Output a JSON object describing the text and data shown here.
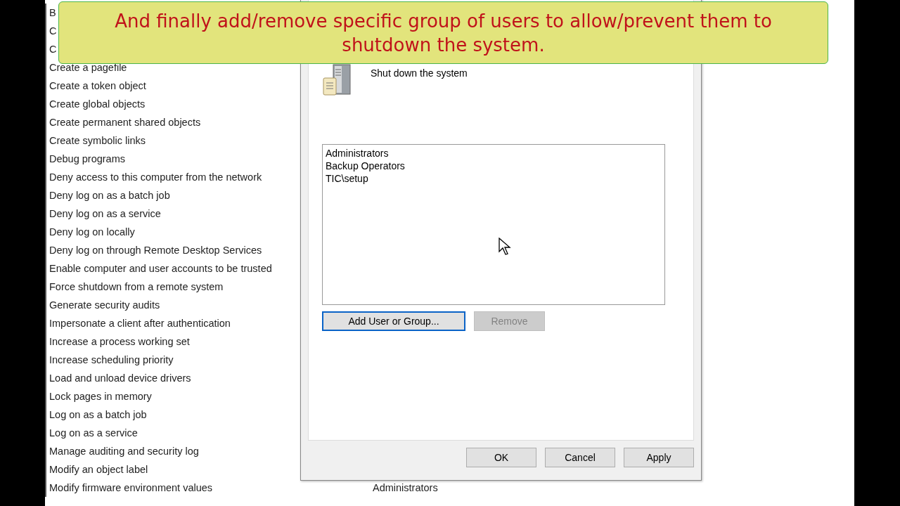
{
  "policies": [
    {
      "name": "B"
    },
    {
      "name": "C"
    },
    {
      "name": "C"
    },
    {
      "name": "Create a pagefile"
    },
    {
      "name": "Create a token object"
    },
    {
      "name": "Create global objects"
    },
    {
      "name": "Create permanent shared objects"
    },
    {
      "name": "Create symbolic links"
    },
    {
      "name": "Debug programs"
    },
    {
      "name": "Deny access to this computer from the network"
    },
    {
      "name": "Deny log on as a batch job"
    },
    {
      "name": "Deny log on as a service"
    },
    {
      "name": "Deny log on locally"
    },
    {
      "name": "Deny log on through Remote Desktop Services"
    },
    {
      "name": "Enable computer and user accounts to be trusted"
    },
    {
      "name": "Force shutdown from a remote system"
    },
    {
      "name": "Generate security audits"
    },
    {
      "name": "Impersonate a client after authentication"
    },
    {
      "name": "Increase a process working set"
    },
    {
      "name": "Increase scheduling priority"
    },
    {
      "name": "Load and unload device drivers"
    },
    {
      "name": "Lock pages in memory"
    },
    {
      "name": "Log on as a batch job"
    },
    {
      "name": "Log on as a service"
    },
    {
      "name": "Manage auditing and security log"
    },
    {
      "name": "Modify an object label"
    },
    {
      "name": "Modify firmware environment values",
      "setting": "Administrators"
    }
  ],
  "dialog": {
    "policy_title": "Shut down the system",
    "members": [
      {
        "name": "Administrators"
      },
      {
        "name": "Backup Operators"
      },
      {
        "name": "TIC\\setup"
      }
    ],
    "member_buttons": [
      {
        "label": "Add User or Group...",
        "disabled": false,
        "focused": true
      },
      {
        "label": "Remove",
        "disabled": true,
        "focused": false
      }
    ],
    "footer_buttons": [
      {
        "label": "OK"
      },
      {
        "label": "Cancel"
      },
      {
        "label": "Apply"
      }
    ]
  },
  "caption": "And finally add/remove specific group of users to allow/prevent them to shutdown the system."
}
